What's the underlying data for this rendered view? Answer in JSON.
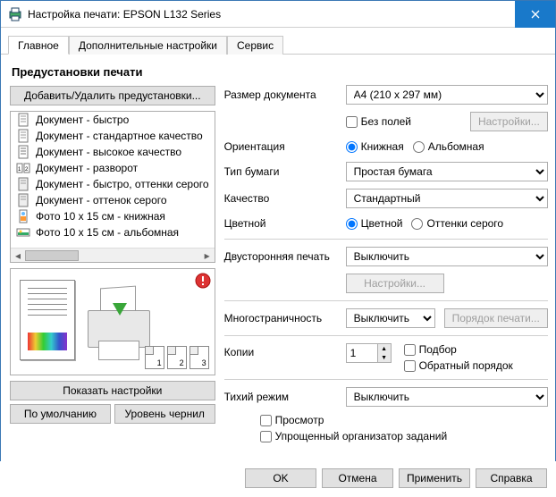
{
  "window": {
    "title": "Настройка печати: EPSON L132 Series"
  },
  "tabs": {
    "main": "Главное",
    "advanced": "Дополнительные настройки",
    "service": "Сервис"
  },
  "presets": {
    "heading": "Предустановки печати",
    "add_remove": "Добавить/Удалить предустановки...",
    "items": [
      "Документ - быстро",
      "Документ - стандартное качество",
      "Документ - высокое качество",
      "Документ - разворот",
      "Документ - быстро, оттенки серого",
      "Документ - оттенок серого",
      "Фото 10 x 15 см - книжная",
      "Фото 10 x 15 см - альбомная"
    ],
    "show_settings": "Показать настройки",
    "defaults": "По умолчанию",
    "ink_levels": "Уровень чернил"
  },
  "settings": {
    "doc_size_label": "Размер документа",
    "doc_size_value": "A4 (210 x 297 мм)",
    "borderless": "Без полей",
    "borderless_settings_btn": "Настройки...",
    "orientation_label": "Ориентация",
    "orientation_portrait": "Книжная",
    "orientation_landscape": "Альбомная",
    "paper_type_label": "Тип бумаги",
    "paper_type_value": "Простая бумага",
    "quality_label": "Качество",
    "quality_value": "Стандартный",
    "color_label": "Цветной",
    "color_color": "Цветной",
    "color_gray": "Оттенки серого",
    "duplex_label": "Двусторонняя печать",
    "duplex_value": "Выключить",
    "duplex_settings_btn": "Настройки...",
    "multipage_label": "Многостраничность",
    "multipage_value": "Выключить",
    "page_order_btn": "Порядок печати...",
    "copies_label": "Копии",
    "copies_value": "1",
    "collate": "Подбор",
    "reverse": "Обратный порядок",
    "quiet_label": "Тихий режим",
    "quiet_value": "Выключить",
    "preview": "Просмотр",
    "simple_organizer": "Упрощенный организатор заданий"
  },
  "buttons": {
    "ok": "OK",
    "cancel": "Отмена",
    "apply": "Применить",
    "help": "Справка"
  }
}
